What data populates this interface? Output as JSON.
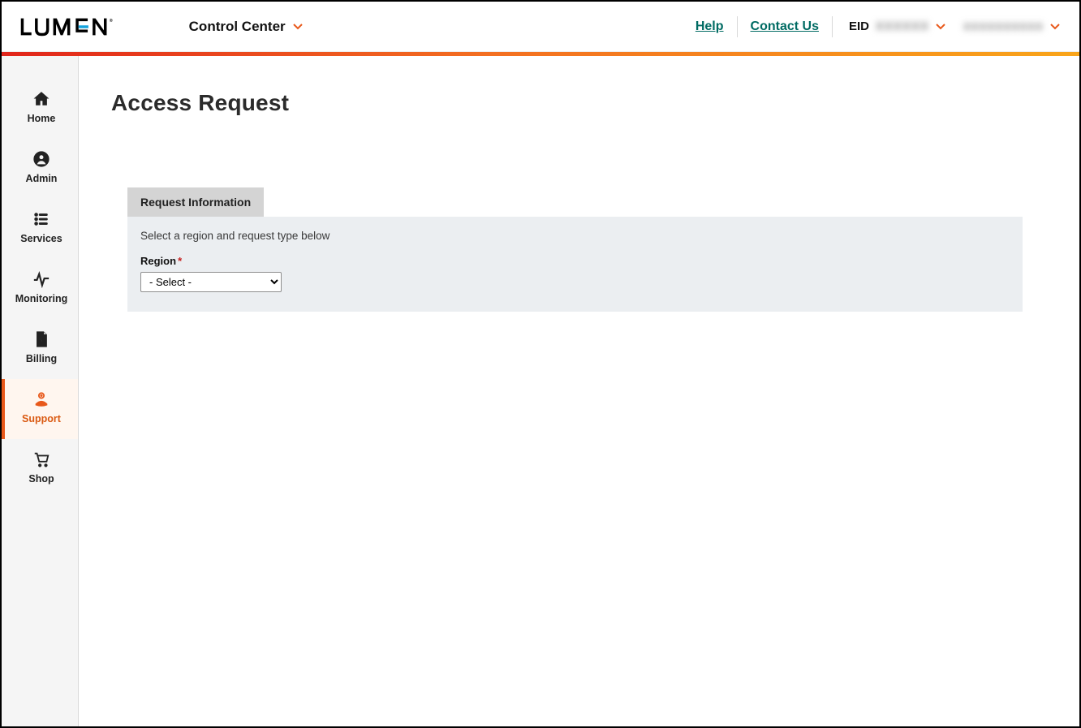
{
  "header": {
    "brand_dropdown": "Control Center",
    "help_label": "Help",
    "contact_label": "Contact Us",
    "eid_prefix": "EID",
    "eid_value_masked": "XXXXXX",
    "user_value_masked": "xxxxxxxxxx"
  },
  "sidebar": {
    "items": [
      {
        "label": "Home",
        "icon": "home-icon"
      },
      {
        "label": "Admin",
        "icon": "user-circle-icon"
      },
      {
        "label": "Services",
        "icon": "list-icon"
      },
      {
        "label": "Monitoring",
        "icon": "activity-icon"
      },
      {
        "label": "Billing",
        "icon": "invoice-icon"
      },
      {
        "label": "Support",
        "icon": "support-hand-icon"
      },
      {
        "label": "Shop",
        "icon": "cart-icon"
      }
    ],
    "active_index": 5
  },
  "page": {
    "title": "Access Request",
    "tab_label": "Request Information",
    "instruction": "Select a region and request type below",
    "region_label": "Region",
    "region_required_marker": "*",
    "region_select_placeholder": "- Select -"
  },
  "icons": {
    "chevron_color_orange": "#e8591b"
  }
}
